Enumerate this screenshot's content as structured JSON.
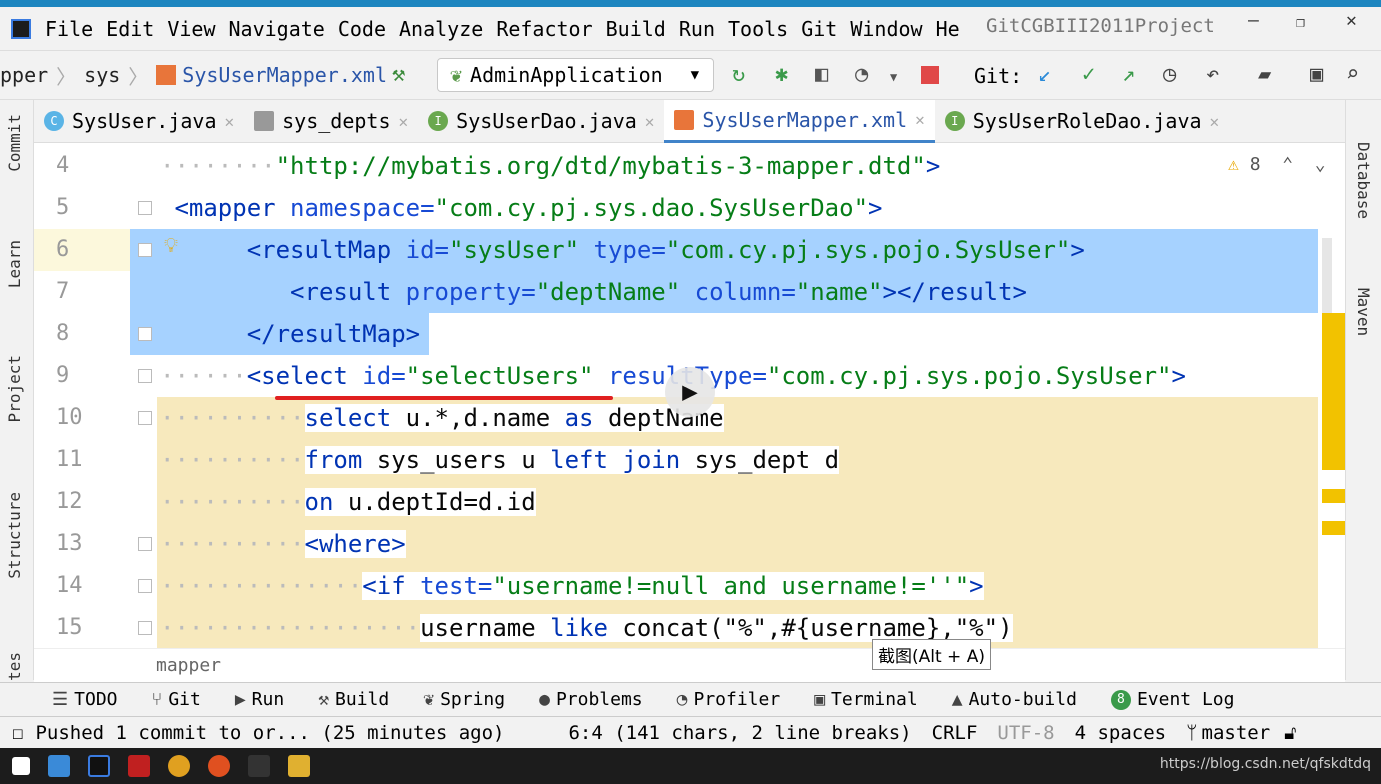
{
  "menu": {
    "items": [
      "File",
      "Edit",
      "View",
      "Navigate",
      "Code",
      "Analyze",
      "Refactor",
      "Build",
      "Run",
      "Tools",
      "Git",
      "Window",
      "He"
    ],
    "title": "GitCGBIII2011Project"
  },
  "nav": {
    "crumbs": [
      "pper",
      "sys",
      "SysUserMapper.xml"
    ],
    "run_config": "AdminApplication",
    "git_label": "Git:"
  },
  "tabs": [
    {
      "label": "SysUser.java",
      "icon": "C",
      "color": "#5ab4e6"
    },
    {
      "label": "sys_depts",
      "icon": "table",
      "color": "#999999"
    },
    {
      "label": "SysUserDao.java",
      "icon": "I",
      "color": "#6aa84f"
    },
    {
      "label": "SysUserMapper.xml",
      "icon": "xml",
      "color": "#e8753a",
      "active": true
    },
    {
      "label": "SysUserRoleDao.java",
      "icon": "I",
      "color": "#6aa84f"
    }
  ],
  "left_tools": [
    "Commit",
    "Learn",
    "Project",
    "Structure",
    "tes"
  ],
  "right_tools": [
    "Database",
    "Maven"
  ],
  "editor": {
    "warnings": "8",
    "lines": [
      {
        "n": "4",
        "bg": "",
        "tokens": [
          [
            "dot",
            "········"
          ],
          [
            "val",
            "\"http://mybatis.org/dtd/mybatis-3-mapper.dtd\""
          ],
          [
            "tag",
            ">"
          ]
        ]
      },
      {
        "n": "5",
        "bg": "",
        "tokens": [
          [
            "tag",
            " <mapper "
          ],
          [
            "attr",
            "namespace="
          ],
          [
            "val",
            "\"com.cy.pj.sys.dao.SysUserDao\""
          ],
          [
            "tag",
            ">"
          ]
        ]
      },
      {
        "n": "6",
        "bg": "sel",
        "tokens": [
          [
            "txt",
            "      "
          ],
          [
            "tag",
            "<resultMap "
          ],
          [
            "attr",
            "id="
          ],
          [
            "val",
            "\"sysUser\" "
          ],
          [
            "attr",
            "type="
          ],
          [
            "val",
            "\"com.cy.pj.sys.pojo.SysUser\""
          ],
          [
            "tag",
            ">"
          ]
        ]
      },
      {
        "n": "7",
        "bg": "sel",
        "tokens": [
          [
            "txt",
            "         "
          ],
          [
            "tag",
            "<result "
          ],
          [
            "attr",
            "property="
          ],
          [
            "val",
            "\"deptName\" "
          ],
          [
            "attr",
            "column="
          ],
          [
            "val",
            "\"name\""
          ],
          [
            "tag",
            "></result>"
          ]
        ]
      },
      {
        "n": "8",
        "bg": "sel",
        "tokens": [
          [
            "txt",
            "      "
          ],
          [
            "tag",
            "</resultMap>"
          ]
        ]
      },
      {
        "n": "9",
        "bg": "",
        "tokens": [
          [
            "dot",
            "······"
          ],
          [
            "tag",
            "<select "
          ],
          [
            "attr",
            "id="
          ],
          [
            "val",
            "\"selectUsers\" "
          ],
          [
            "attr",
            "resultType="
          ],
          [
            "val",
            "\"com.cy.pj.sys.pojo.SysUser\""
          ],
          [
            "tag",
            ">"
          ]
        ]
      },
      {
        "n": "10",
        "bg": "yel",
        "tokens": [
          [
            "dot",
            "··········"
          ],
          [
            "kw",
            "select "
          ],
          [
            "txt",
            "u.*,d.name "
          ],
          [
            "kw",
            "as "
          ],
          [
            "txt",
            "deptName"
          ]
        ]
      },
      {
        "n": "11",
        "bg": "yel",
        "tokens": [
          [
            "dot",
            "··········"
          ],
          [
            "kw",
            "from "
          ],
          [
            "txt",
            "sys_users u "
          ],
          [
            "kw",
            "left join "
          ],
          [
            "txt",
            "sys_dept d"
          ]
        ]
      },
      {
        "n": "12",
        "bg": "yel",
        "tokens": [
          [
            "dot",
            "··········"
          ],
          [
            "kw",
            "on "
          ],
          [
            "txt",
            "u.deptId=d.id"
          ]
        ]
      },
      {
        "n": "13",
        "bg": "yel",
        "tokens": [
          [
            "dot",
            "··········"
          ],
          [
            "tag",
            "<where>"
          ]
        ]
      },
      {
        "n": "14",
        "bg": "yel",
        "tokens": [
          [
            "dot",
            "··············"
          ],
          [
            "tag",
            "<if "
          ],
          [
            "attr",
            "test="
          ],
          [
            "val",
            "\"username!=null and username!=''\""
          ],
          [
            "tag",
            ">"
          ]
        ]
      },
      {
        "n": "15",
        "bg": "yel",
        "tokens": [
          [
            "dot",
            "··················"
          ],
          [
            "txt",
            "username "
          ],
          [
            "kw",
            "like "
          ],
          [
            "txt",
            "concat(\"%\",#{username},\"%\")"
          ]
        ]
      }
    ]
  },
  "breadcrumb_bottom": "mapper",
  "tooltip": "截图(Alt + A)",
  "toolwindows": [
    "TODO",
    "Git",
    "Run",
    "Build",
    "Spring",
    "Problems",
    "Profiler",
    "Terminal",
    "Auto-build",
    "Event Log"
  ],
  "event_count": "8",
  "status": {
    "message": "Pushed 1 commit to or... (25 minutes ago)",
    "position": "6:4 (141 chars, 2 line breaks)",
    "line_sep": "CRLF",
    "encoding": "UTF-8",
    "indent": "4 spaces",
    "branch": "master"
  },
  "tray": "https://blog.csdn.net/qfskdtdq"
}
